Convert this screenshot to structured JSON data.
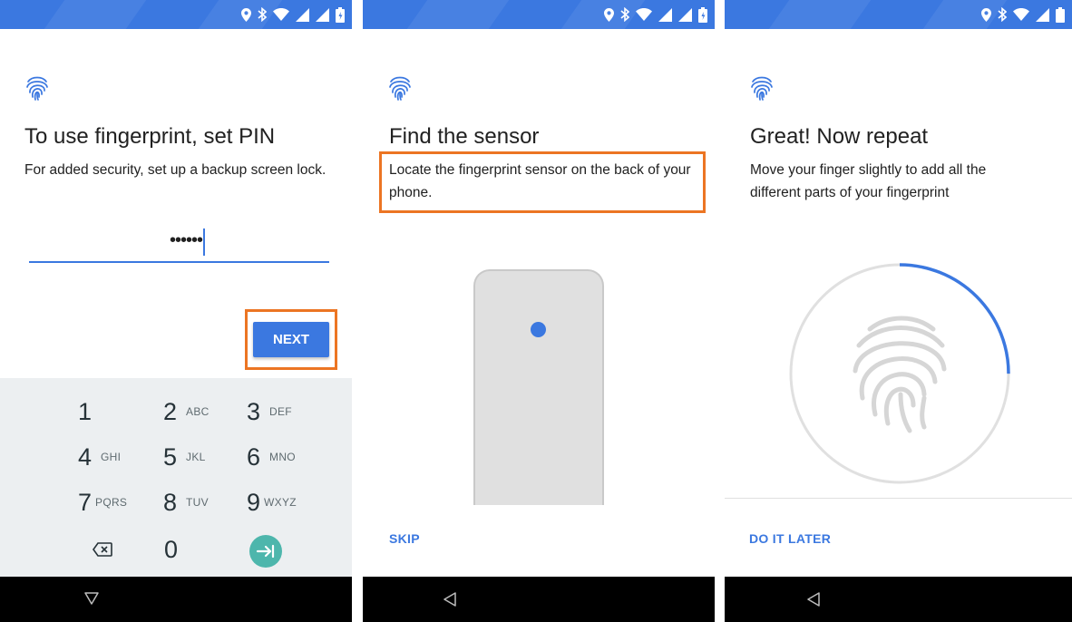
{
  "screens": [
    {
      "title": "To use fingerprint, set PIN",
      "subtitle": "For added security, set up a backup screen lock.",
      "pin_masked": "••••••",
      "next_label": "NEXT",
      "keypad": [
        {
          "num": "1",
          "letters": ""
        },
        {
          "num": "2",
          "letters": "ABC"
        },
        {
          "num": "3",
          "letters": "DEF"
        },
        {
          "num": "4",
          "letters": "GHI"
        },
        {
          "num": "5",
          "letters": "JKL"
        },
        {
          "num": "6",
          "letters": "MNO"
        },
        {
          "num": "7",
          "letters": "PQRS"
        },
        {
          "num": "8",
          "letters": "TUV"
        },
        {
          "num": "9",
          "letters": "WXYZ"
        },
        {
          "num": "",
          "letters": ""
        },
        {
          "num": "0",
          "letters": ""
        },
        {
          "num": "",
          "letters": ""
        }
      ]
    },
    {
      "title": "Find the sensor",
      "subtitle": "Locate the fingerprint sensor on the back of your phone.",
      "skip_label": "SKIP"
    },
    {
      "title": "Great! Now repeat",
      "subtitle": "Move your finger slightly to add all the different parts of your fingerprint",
      "enroll_progress": 0.25,
      "later_label": "DO IT LATER"
    }
  ],
  "icons": {
    "status": [
      "location-icon",
      "bluetooth-icon",
      "wifi-icon",
      "signal-icon",
      "battery-icon"
    ],
    "fingerprint": "fingerprint-icon",
    "backspace": "backspace-icon",
    "enter": "enter-icon",
    "nav_back": "back-icon"
  },
  "colors": {
    "accent": "#3b78e0",
    "highlight": "#ec7523",
    "keypad_bg": "#eceff1",
    "enter_key": "#4db6ac",
    "navbar": "#000000"
  }
}
